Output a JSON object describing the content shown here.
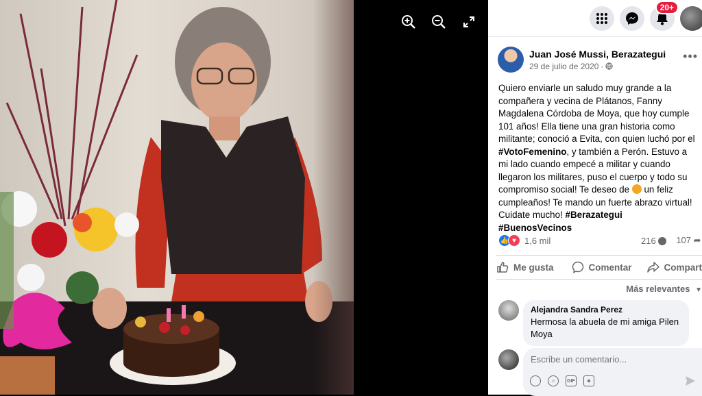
{
  "post": {
    "author": "Juan José Mussi, Berazategui",
    "date": "29 de julio de 2020",
    "text_p1": "Quiero enviarle un saludo muy grande a la compañera y vecina de Plátanos, Fanny Magdalena Córdoba de Moya, que hoy cumple 101 años! Ella tiene una gran historia como militante; conoció a Evita, con quien luchó por el ",
    "hashtag1": "#VotoFemenino",
    "text_p2": ", y también a Perón. Estuvo a mi lado cuando empecé a militar y cuando llegaron los militares, puso el cuerpo y todo su compromiso social! Te deseo de ",
    "text_p3": " un feliz cumpleaños! Te mando un fuerte abrazo virtual! Cuidate mucho! ",
    "hashtag2": "#Berazategui",
    "hashtag3": "#BuenosVecinos"
  },
  "stats": {
    "reactions": "1,6 mil",
    "comments": "216",
    "shares": "107"
  },
  "actions": {
    "like": "Me gusta",
    "comment": "Comentar",
    "share": "Compartir"
  },
  "sort_label": "Más relevantes",
  "comment": {
    "author": "Alejandra Sandra Perez",
    "text": "Hermosa la abuela de mi amiga Pilen Moya"
  },
  "compose": {
    "placeholder": "Escribe un comentario..."
  },
  "notifications_badge": "20+",
  "colors": {
    "accent": "#1877f2",
    "badge": "#e41e3f",
    "love": "#f33e58"
  }
}
